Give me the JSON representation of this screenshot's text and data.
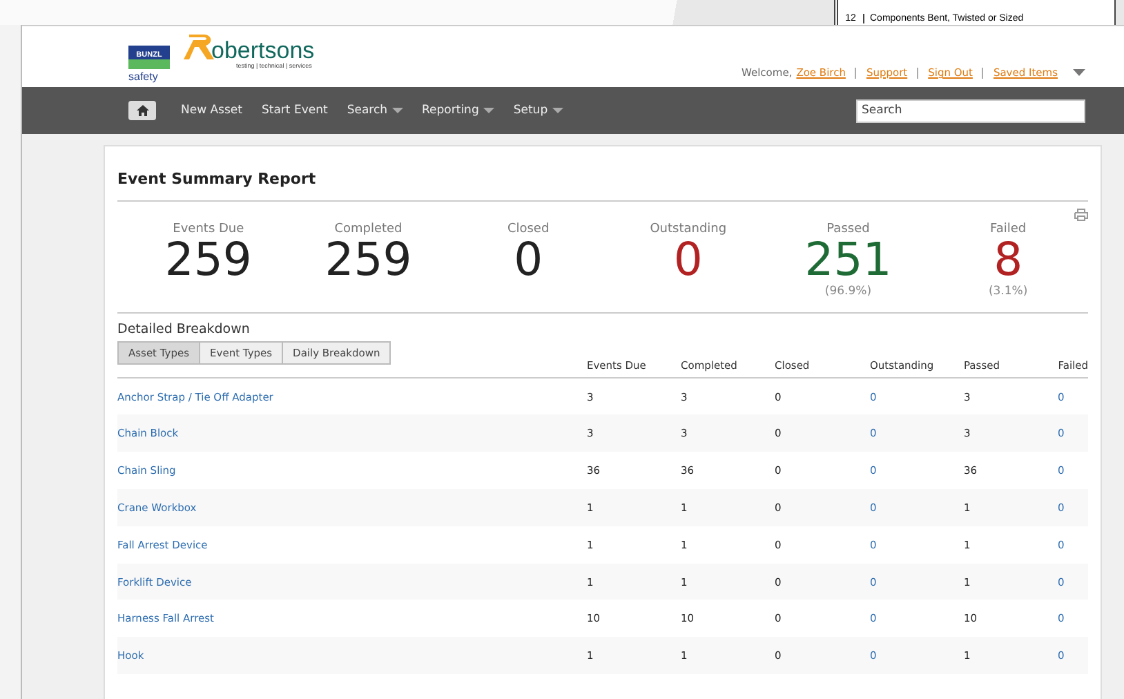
{
  "backdrop": {
    "row_number": "12",
    "row_text": "Components Bent, Twisted or Sized"
  },
  "header": {
    "brand_top": "BUNZL",
    "brand_bottom": "safety",
    "logo_name": "obertsons",
    "logo_tagline": "testing | technical | services",
    "welcome": "Welcome,",
    "user": "Zoe Birch",
    "links": [
      "Support",
      "Sign Out",
      "Saved Items"
    ]
  },
  "nav": {
    "items": [
      {
        "label": "New Asset",
        "dropdown": false
      },
      {
        "label": "Start Event",
        "dropdown": false
      },
      {
        "label": "Search",
        "dropdown": true
      },
      {
        "label": "Reporting",
        "dropdown": true
      },
      {
        "label": "Setup",
        "dropdown": true
      }
    ],
    "search": {
      "placeholder": "Search"
    }
  },
  "report": {
    "title": "Event Summary Report",
    "metrics": [
      {
        "label": "Events Due",
        "value": "259",
        "color": "#222222"
      },
      {
        "label": "Completed",
        "value": "259",
        "color": "#222222"
      },
      {
        "label": "Closed",
        "value": "0",
        "color": "#222222"
      },
      {
        "label": "Outstanding",
        "value": "0",
        "color": "#b22222"
      },
      {
        "label": "Passed",
        "value": "251",
        "percent": "(96.9%)",
        "color": "#1e6b35"
      },
      {
        "label": "Failed",
        "value": "8",
        "percent": "(3.1%)",
        "color": "#b22222"
      }
    ],
    "breakdown_title": "Detailed Breakdown",
    "tabs": [
      {
        "label": "Asset Types",
        "selected": true
      },
      {
        "label": "Event Types",
        "selected": false
      },
      {
        "label": "Daily Breakdown",
        "selected": false
      }
    ],
    "columns": [
      {
        "label": "Events Due",
        "kind": "plain"
      },
      {
        "label": "Completed",
        "kind": "plain"
      },
      {
        "label": "Closed",
        "kind": "plain"
      },
      {
        "label": "Outstanding",
        "kind": "link"
      },
      {
        "label": "Passed",
        "kind": "plain"
      },
      {
        "label": "Failed",
        "kind": "link"
      }
    ],
    "rows": [
      {
        "name": "Anchor Strap / Tie Off Adapter",
        "values": [
          "3",
          "3",
          "0",
          "0",
          "3",
          "0"
        ]
      },
      {
        "name": "Chain Block",
        "values": [
          "3",
          "3",
          "0",
          "0",
          "3",
          "0"
        ]
      },
      {
        "name": "Chain Sling",
        "values": [
          "36",
          "36",
          "0",
          "0",
          "36",
          "0"
        ]
      },
      {
        "name": "Crane Workbox",
        "values": [
          "1",
          "1",
          "0",
          "0",
          "1",
          "0"
        ]
      },
      {
        "name": "Fall Arrest Device",
        "values": [
          "1",
          "1",
          "0",
          "0",
          "1",
          "0"
        ]
      },
      {
        "name": "Forklift Device",
        "values": [
          "1",
          "1",
          "0",
          "0",
          "1",
          "0"
        ]
      },
      {
        "name": "Harness Fall Arrest",
        "values": [
          "10",
          "10",
          "0",
          "0",
          "10",
          "0"
        ]
      },
      {
        "name": "Hook",
        "values": [
          "1",
          "1",
          "0",
          "0",
          "1",
          "0"
        ]
      }
    ]
  }
}
